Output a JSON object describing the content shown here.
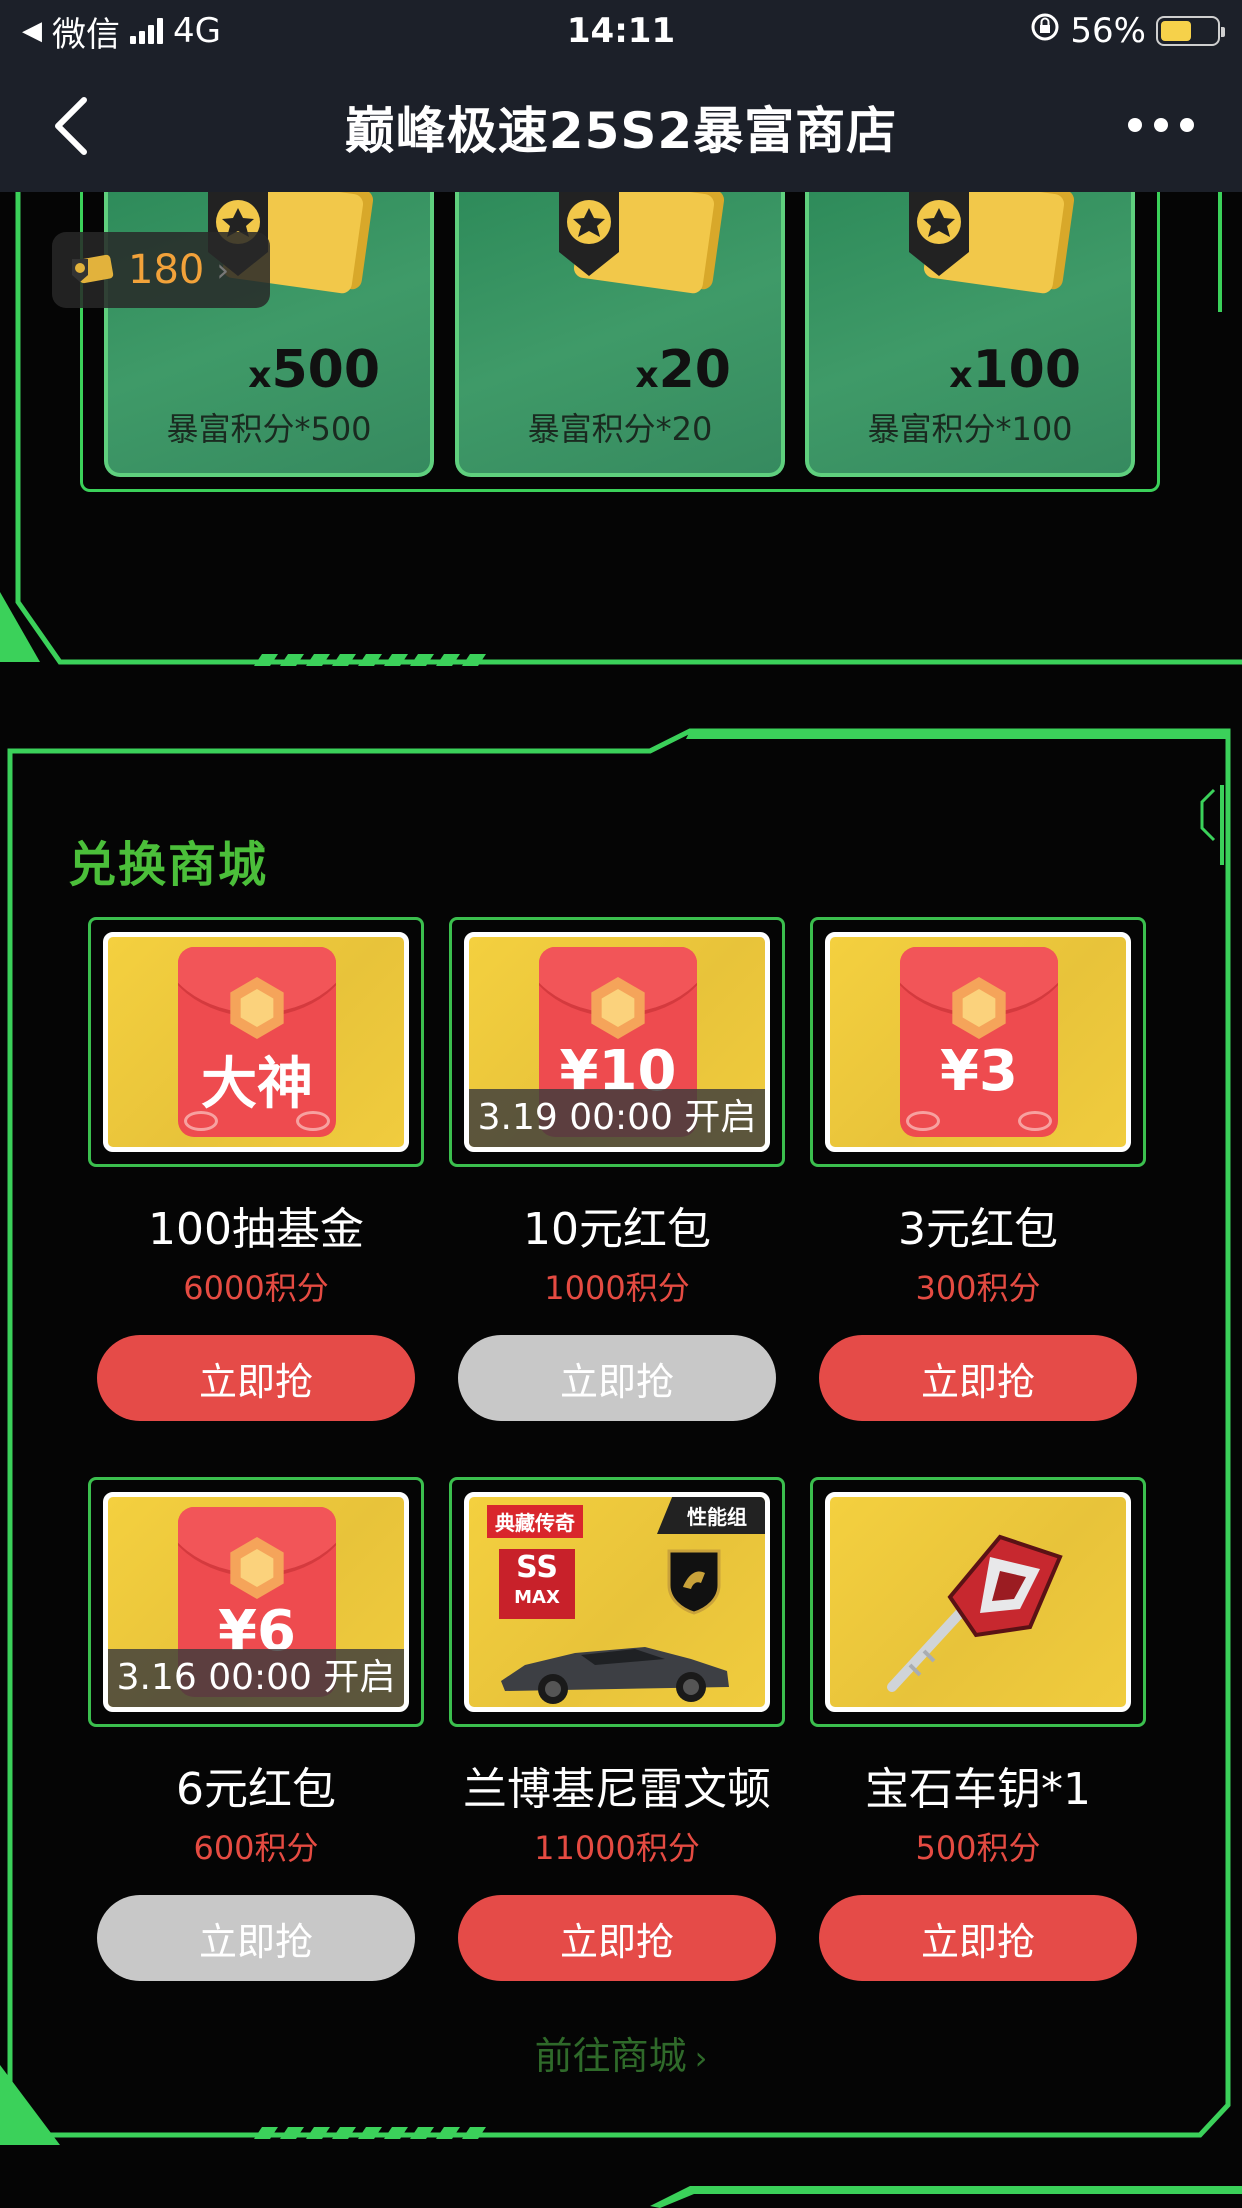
{
  "status_bar": {
    "carrier": "微信",
    "network": "4G",
    "time": "14:11",
    "battery": "56%",
    "battery_level": 0.56
  },
  "nav": {
    "title": "巅峰极速25S2暴富商店"
  },
  "coin_badge": {
    "value": "180"
  },
  "rewards": [
    {
      "qty_prefix": "x",
      "qty": "500",
      "label": "暴富积分*500"
    },
    {
      "qty_prefix": "x",
      "qty": "20",
      "label": "暴富积分*20"
    },
    {
      "qty_prefix": "x",
      "qty": "100",
      "label": "暴富积分*100"
    }
  ],
  "shop": {
    "title": "兑换商城",
    "goto_label": "前往商城",
    "items": [
      {
        "thumb_text": "大神",
        "timer": "",
        "name": "100抽基金",
        "price": "6000积分",
        "button": "立即抢",
        "enabled": true
      },
      {
        "thumb_text": "¥10",
        "timer": "3.19 00:00 开启",
        "name": "10元红包",
        "price": "1000积分",
        "button": "立即抢",
        "enabled": false
      },
      {
        "thumb_text": "¥3",
        "timer": "",
        "name": "3元红包",
        "price": "300积分",
        "button": "立即抢",
        "enabled": true
      },
      {
        "thumb_text": "¥6",
        "timer": "3.16 00:00 开启",
        "name": "6元红包",
        "price": "600积分",
        "button": "立即抢",
        "enabled": false
      },
      {
        "thumb_text": "",
        "timer": "",
        "name": "兰博基尼雷文顿",
        "price": "11000积分",
        "button": "立即抢",
        "enabled": true,
        "tag_left": "典藏传奇",
        "tag_right": "性能组",
        "badge_top": "SS",
        "badge_bottom": "MAX",
        "brand": "LAMBORGHINI"
      },
      {
        "thumb_text": "",
        "timer": "",
        "name": "宝石车钥*1",
        "price": "500积分",
        "button": "立即抢",
        "enabled": true
      }
    ]
  },
  "colors": {
    "accent_green": "#3bd15a",
    "button_red": "#e54b48",
    "button_disabled": "#c8c8c8",
    "price_red": "#e54b42"
  }
}
